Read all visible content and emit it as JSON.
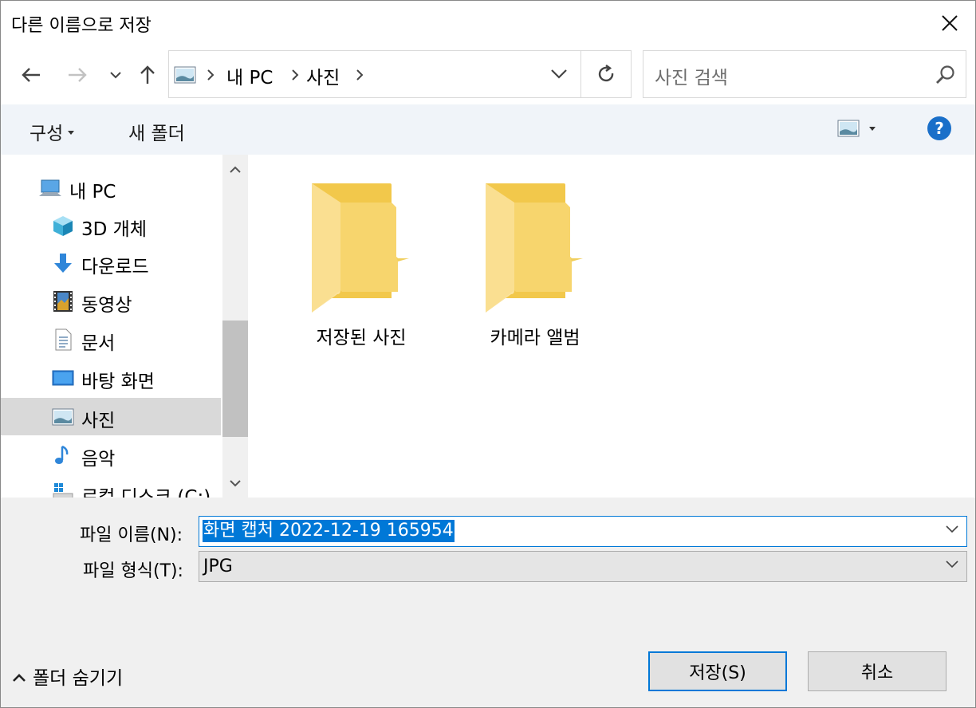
{
  "window": {
    "title": "다른 이름으로 저장"
  },
  "address": {
    "crumbs": [
      "내 PC",
      "사진"
    ]
  },
  "search": {
    "placeholder": "사진 검색"
  },
  "toolbar": {
    "organize": "구성",
    "new_folder": "새 폴더"
  },
  "sidebar": {
    "items": [
      {
        "label": "내 PC",
        "icon": "computer-icon"
      },
      {
        "label": "3D 개체",
        "icon": "cube-3d-icon"
      },
      {
        "label": "다운로드",
        "icon": "download-arrow-icon"
      },
      {
        "label": "동영상",
        "icon": "film-icon"
      },
      {
        "label": "문서",
        "icon": "document-icon"
      },
      {
        "label": "바탕 화면",
        "icon": "desktop-icon"
      },
      {
        "label": "사진",
        "icon": "picture-icon",
        "selected": true
      },
      {
        "label": "음악",
        "icon": "music-note-icon"
      },
      {
        "label": "로컬 디스크 (C:)",
        "icon": "drive-icon"
      }
    ]
  },
  "content": {
    "folders": [
      {
        "label": "저장된 사진"
      },
      {
        "label": "카메라 앨범"
      }
    ]
  },
  "fields": {
    "filename_label": "파일 이름(N):",
    "filename_value": "화면 캡처 2022-12-19 165954",
    "filetype_label": "파일 형식(T):",
    "filetype_value": "JPG"
  },
  "footer": {
    "hide_folders": "폴더 숨기기",
    "save": "저장(S)",
    "cancel": "취소"
  },
  "colors": {
    "accent": "#0078d7",
    "folder": "#f8d775",
    "toolbar_bg": "#f0f4f9",
    "bottom_bg": "#f0f0f0"
  }
}
